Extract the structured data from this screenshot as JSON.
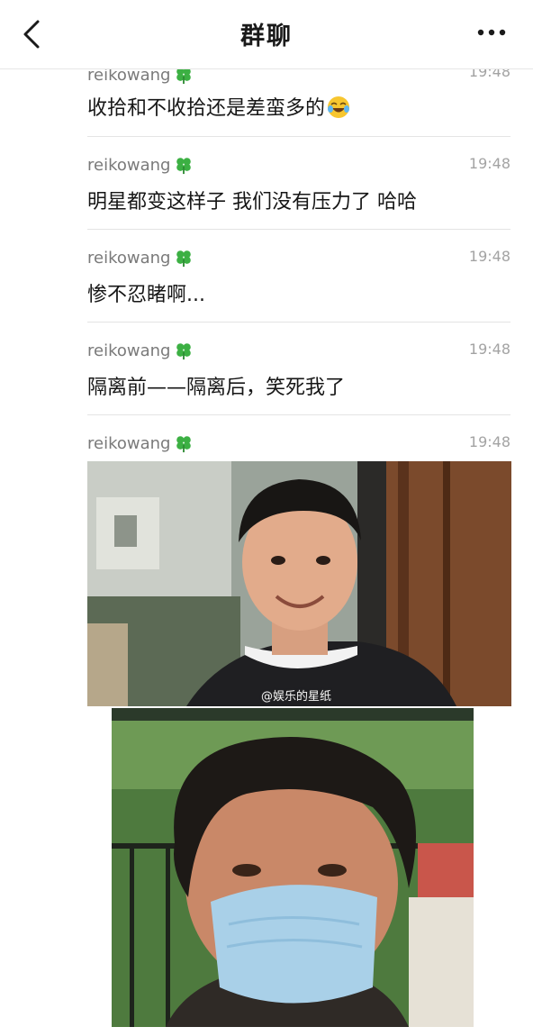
{
  "header": {
    "title": "群聊",
    "back_icon": "chevron-left-icon",
    "more_icon": "more-dots-icon"
  },
  "messages": [
    {
      "user": "reikowang",
      "time": "19:48",
      "text": "收拾和不收拾还是差蛮多的"
    },
    {
      "user": "reikowang",
      "time": "19:48",
      "text": "明星都变这样子 我们没有压力了 哈哈"
    },
    {
      "user": "reikowang",
      "time": "19:48",
      "text": "惨不忍睹啊..."
    },
    {
      "user": "reikowang",
      "time": "19:48",
      "text": "隔离前——隔离后，笑死我了"
    },
    {
      "user": "reikowang",
      "time": "19:48",
      "text": ""
    }
  ],
  "watermark": "@娱乐的星纸",
  "colors": {
    "accent_clover": "#3cb043",
    "divider": "#e4e4e4"
  }
}
